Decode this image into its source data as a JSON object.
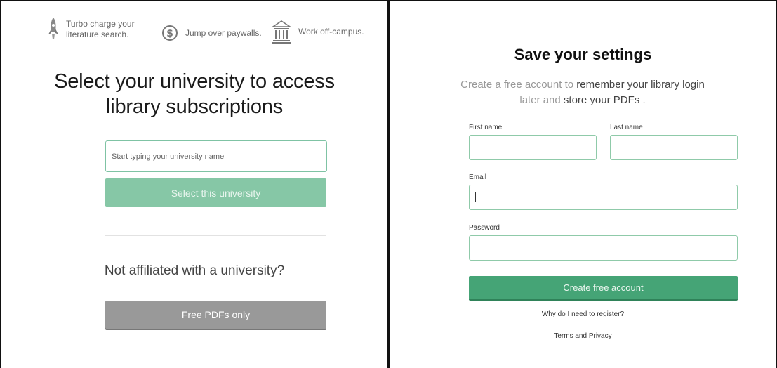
{
  "left": {
    "features": [
      {
        "icon": "rocket-icon",
        "text": "Turbo charge your\nliterature search."
      },
      {
        "icon": "dollar-circle-icon",
        "text": "Jump over paywalls."
      },
      {
        "icon": "university-building-icon",
        "text": "Work off-campus."
      }
    ],
    "heading": "Select your university to access\nlibrary subscriptions",
    "university_search": {
      "value": "",
      "placeholder": "Start typing your university name"
    },
    "select_button": "Select this university",
    "not_affiliated": "Not affiliated with a university?",
    "free_pdfs_button": "Free PDFs only"
  },
  "right": {
    "title": "Save your settings",
    "subtitle": {
      "part1": "Create a free account to ",
      "hl1": "remember your library login",
      "part2": " later and ",
      "hl2": "store your PDFs",
      "part3": " ."
    },
    "first_name_label": "First name",
    "last_name_label": "Last name",
    "email_label": "Email",
    "password_label": "Password",
    "first_name_value": "",
    "last_name_value": "",
    "email_value": "",
    "password_value": "",
    "create_button": "Create free account",
    "why_register_link": "Why do I need to register?",
    "terms_link": "Terms and Privacy"
  },
  "colors": {
    "accent_green": "#45a476",
    "light_green": "#86c7a6",
    "gray_button": "#999999"
  }
}
